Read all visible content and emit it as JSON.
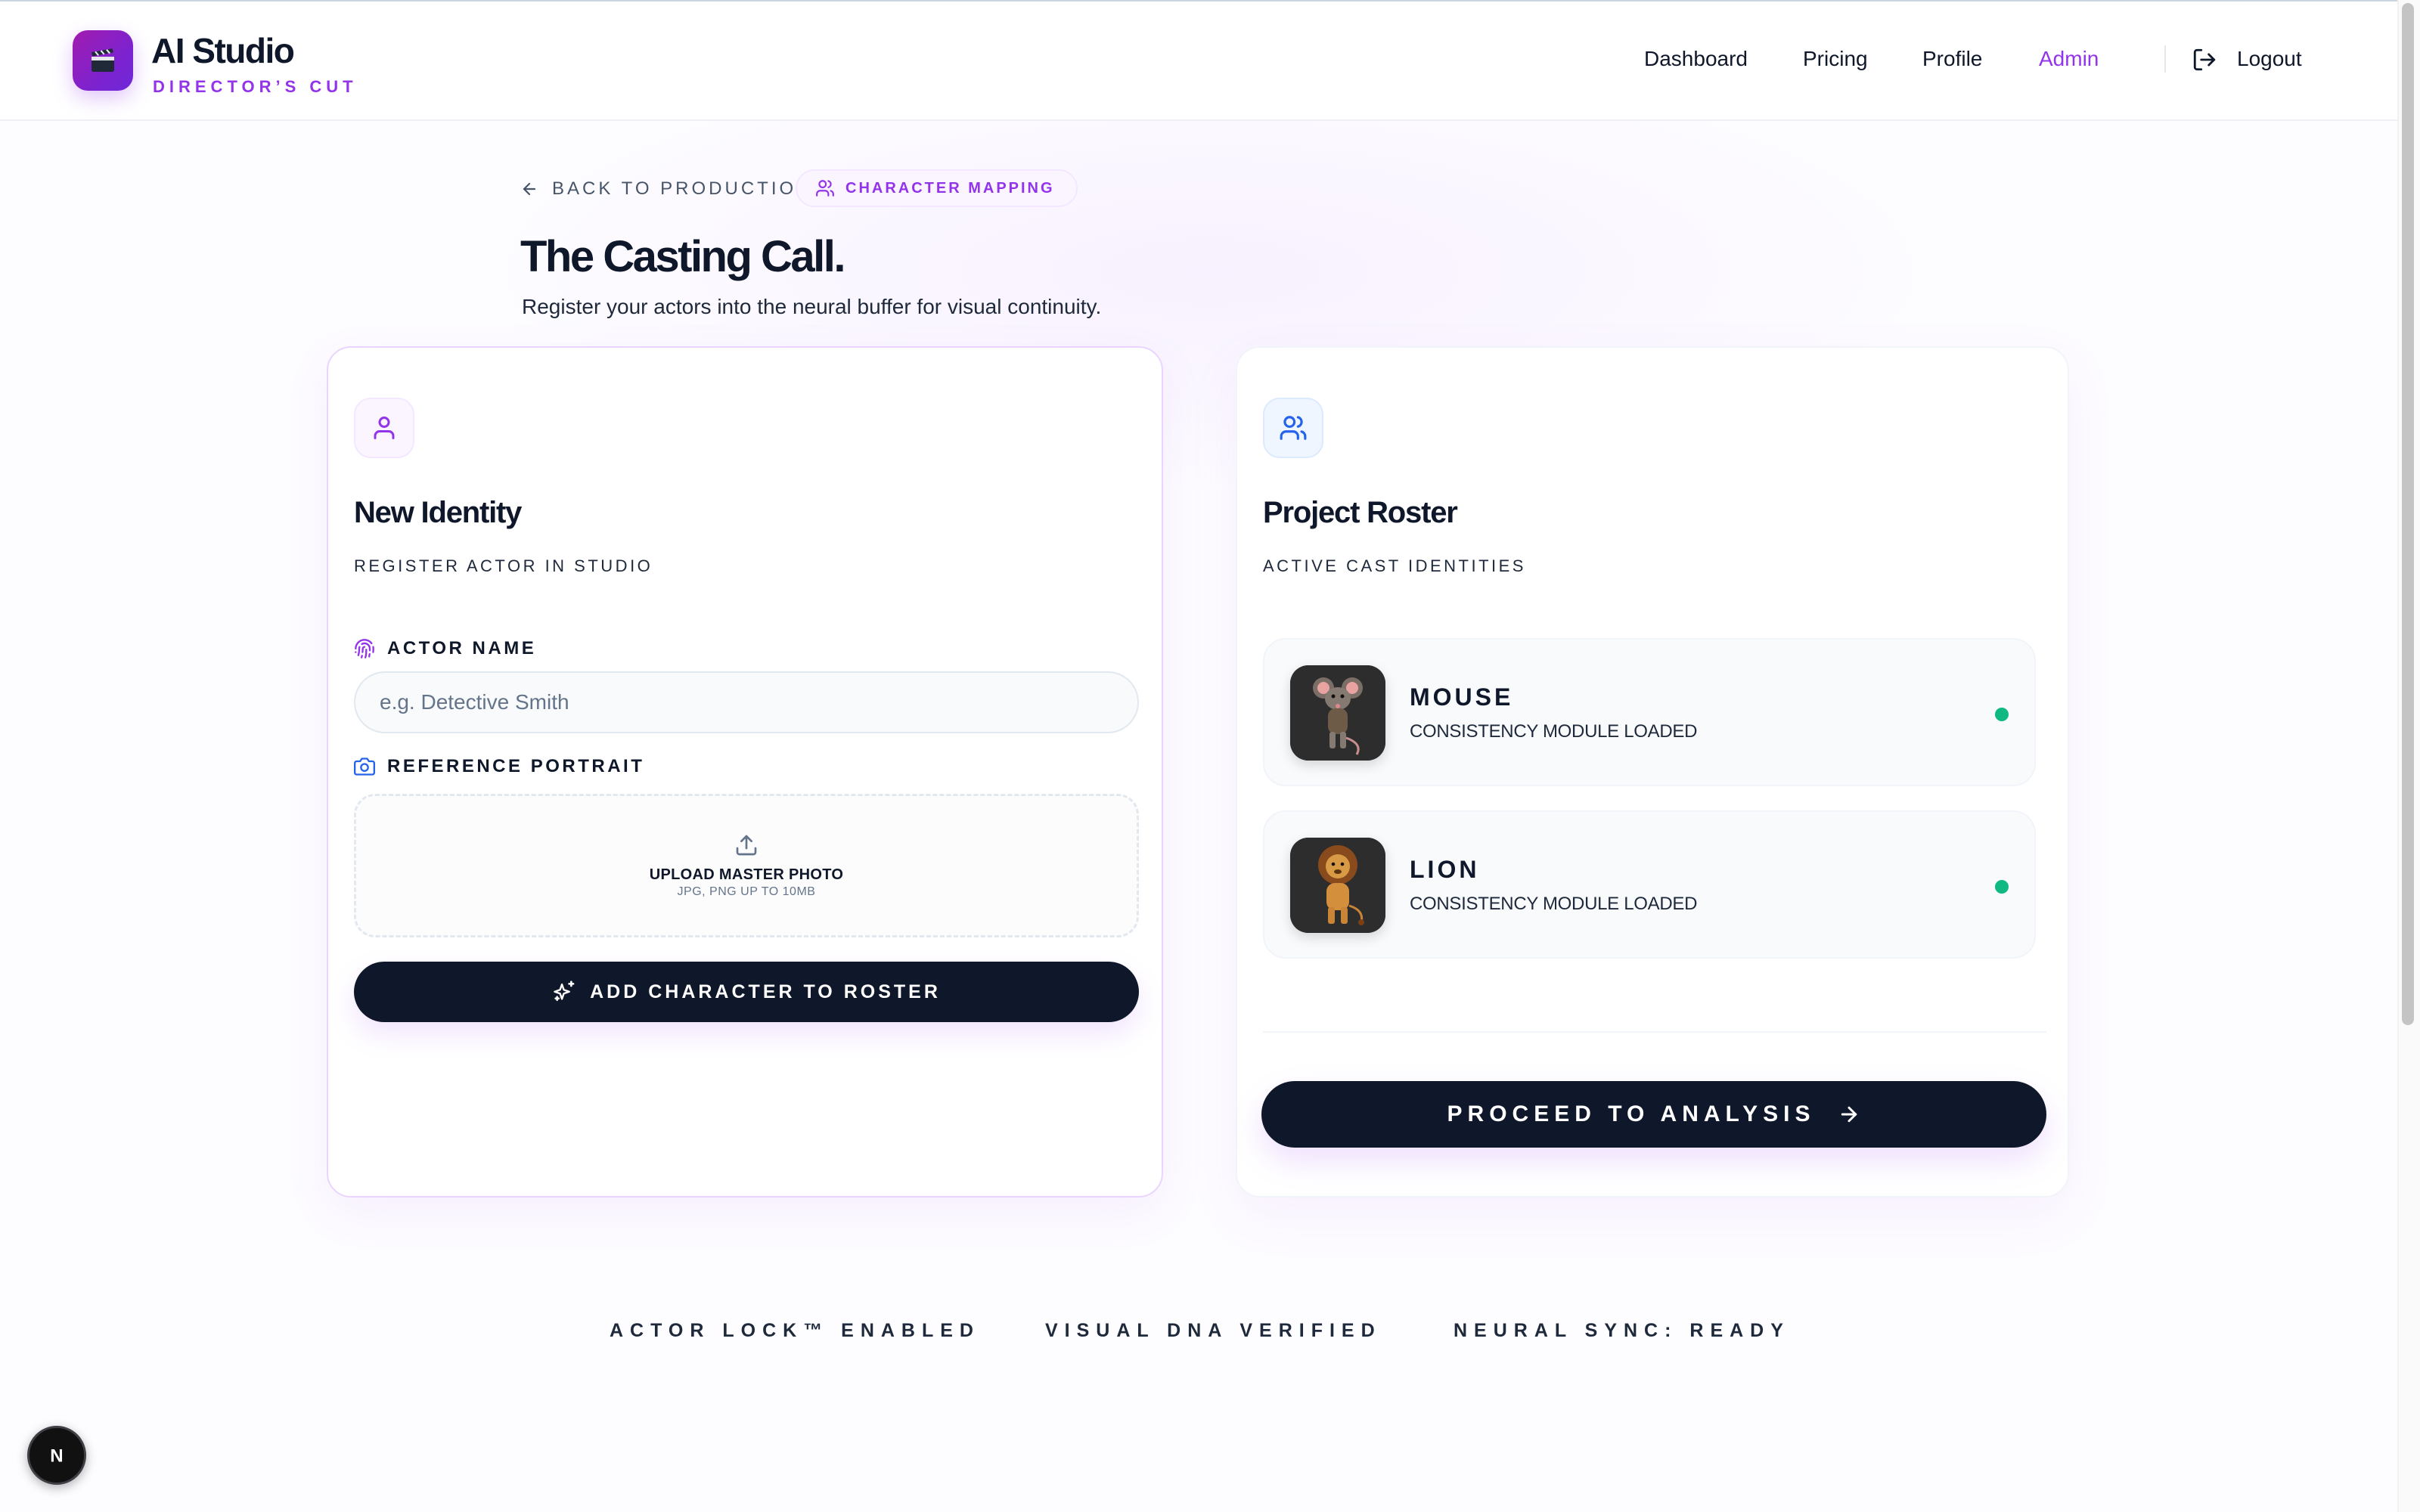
{
  "header": {
    "brand_title": "AI Studio",
    "brand_subtitle": "DIRECTOR’S CUT",
    "logo_icon": "clapperboard-icon",
    "nav": [
      {
        "label": "Dashboard",
        "active": false
      },
      {
        "label": "Pricing",
        "active": false
      },
      {
        "label": "Profile",
        "active": false
      },
      {
        "label": "Admin",
        "active": true
      }
    ],
    "logout_label": "Logout"
  },
  "breadcrumb": {
    "back_label": "BACK TO PRODUCTION",
    "chip_label": "CHARACTER MAPPING"
  },
  "page": {
    "title": "The Casting Call.",
    "subtitle": "Register your actors into the neural buffer for visual continuity."
  },
  "new_identity": {
    "title": "New Identity",
    "subtitle": "REGISTER ACTOR IN STUDIO",
    "actor_name_label": "ACTOR NAME",
    "actor_name_value": "",
    "actor_name_placeholder": "e.g. Detective Smith",
    "portrait_label": "REFERENCE PORTRAIT",
    "upload_title": "UPLOAD MASTER PHOTO",
    "upload_hint": "JPG, PNG UP TO 10MB",
    "add_button": "ADD CHARACTER TO ROSTER"
  },
  "roster": {
    "title": "Project Roster",
    "subtitle": "ACTIVE CAST IDENTITIES",
    "items": [
      {
        "name": "MOUSE",
        "status": "CONSISTENCY MODULE LOADED",
        "avatar": "mouse-avatar"
      },
      {
        "name": "LION",
        "status": "CONSISTENCY MODULE LOADED",
        "avatar": "lion-avatar"
      }
    ],
    "proceed_button": "PROCEED TO ANALYSIS"
  },
  "footer": {
    "badges": [
      "ACTOR LOCK™ ENABLED",
      "VISUAL DNA VERIFIED",
      "NEURAL SYNC: READY"
    ]
  },
  "dev_widget": {
    "label": "N"
  },
  "colors": {
    "accent": "#9333ea",
    "dark": "#0f172a",
    "status_ok": "#10b981"
  }
}
